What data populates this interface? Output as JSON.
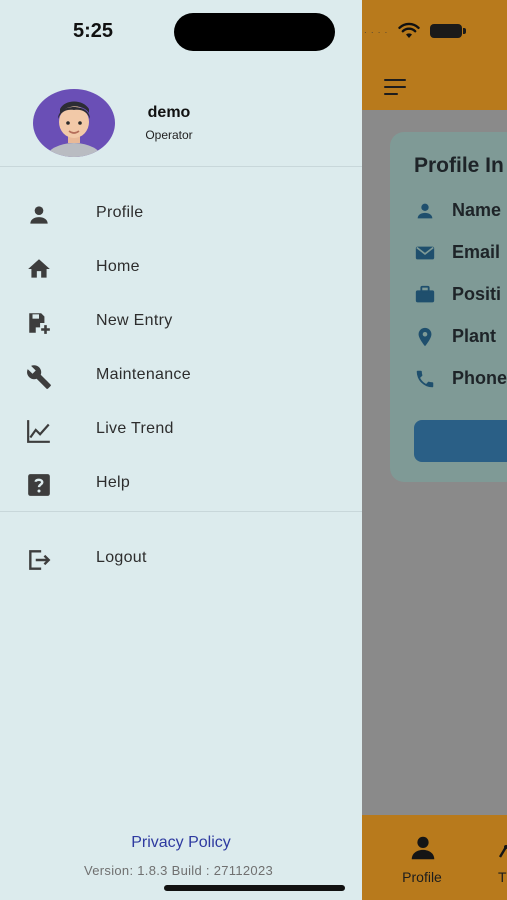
{
  "status_bar": {
    "time": "5:25"
  },
  "user": {
    "name": "demo",
    "role": "Operator"
  },
  "menu": [
    {
      "label": "Profile",
      "icon": "person-icon"
    },
    {
      "label": "Home",
      "icon": "home-icon"
    },
    {
      "label": "New Entry",
      "icon": "new-entry-icon"
    },
    {
      "label": "Maintenance",
      "icon": "wrench-icon"
    },
    {
      "label": "Live Trend",
      "icon": "trend-chart-icon"
    },
    {
      "label": "Help",
      "icon": "help-icon"
    }
  ],
  "logout": {
    "label": "Logout",
    "icon": "logout-icon"
  },
  "footer": {
    "privacy_policy": "Privacy Policy",
    "version": "Version: 1.8.3   Build : 27112023"
  },
  "background_screen": {
    "card_title": "Profile In",
    "rows": [
      {
        "label": "Name",
        "icon": "person-icon"
      },
      {
        "label": "Email",
        "icon": "mail-icon"
      },
      {
        "label": "Positi",
        "icon": "briefcase-icon"
      },
      {
        "label": "Plant",
        "icon": "location-pin-icon"
      },
      {
        "label": "Phone",
        "icon": "phone-icon"
      }
    ],
    "bottom_nav": [
      {
        "label": "Profile",
        "icon": "person-icon"
      },
      {
        "label": "T",
        "icon": "tab-icon"
      }
    ]
  },
  "colors": {
    "drawer_bg": "#dcebed",
    "app_bar": "#b87a1c",
    "privacy_link": "#2e3aa0",
    "avatar_bg": "#6a4fb6",
    "primary_button": "#2a5f86"
  }
}
